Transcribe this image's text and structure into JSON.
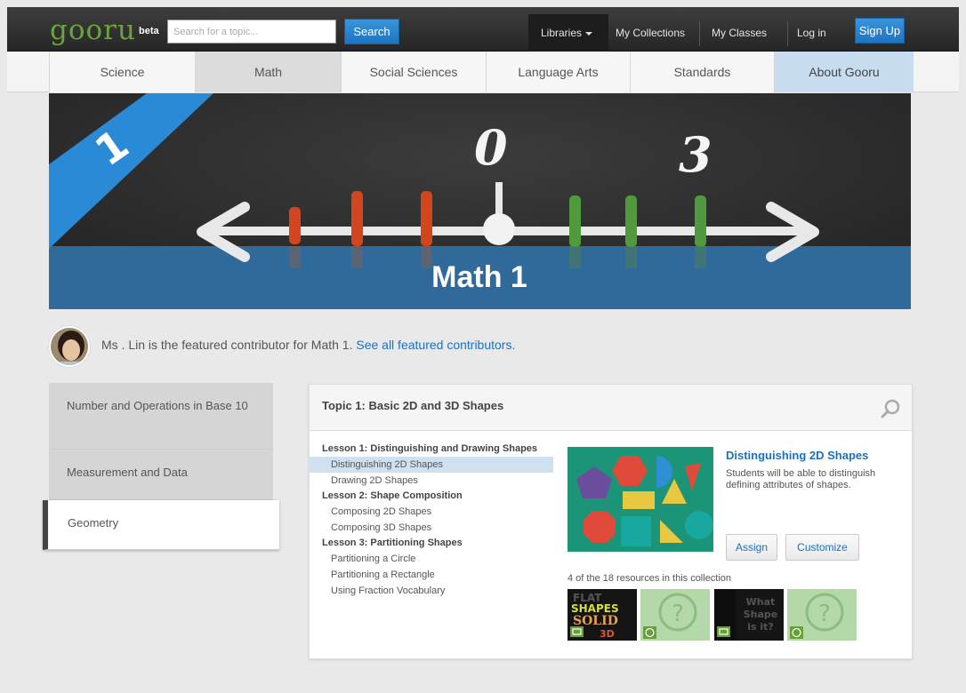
{
  "header": {
    "logo": "gooru",
    "beta": "beta",
    "search_placeholder": "Search for a topic...",
    "search_button": "Search",
    "libraries": "Libraries",
    "my_collections": "My Collections",
    "my_classes": "My Classes",
    "login": "Log in",
    "signup": "Sign Up"
  },
  "tabs": [
    "Science",
    "Math",
    "Social Sciences",
    "Language Arts",
    "Standards",
    "About Gooru"
  ],
  "banner": {
    "title": "Math 1",
    "grade": "1",
    "numbers": [
      "0",
      "3"
    ]
  },
  "contributor": {
    "text": "Ms . Lin is the featured contributor for Math 1.",
    "link": "See all featured contributors."
  },
  "sidebar": {
    "items": [
      {
        "label": "Number and Operations in Base 10"
      },
      {
        "label": "Measurement and Data"
      },
      {
        "label": "Geometry"
      }
    ]
  },
  "topic": {
    "title": "Topic 1: Basic 2D and 3D Shapes",
    "lessons": [
      {
        "title": "Lesson 1: Distinguishing and Drawing Shapes",
        "items": [
          "Distinguishing 2D Shapes",
          "Drawing 2D Shapes"
        ]
      },
      {
        "title": "Lesson 2: Shape Composition",
        "items": [
          "Composing 2D Shapes",
          "Composing 3D Shapes"
        ]
      },
      {
        "title": "Lesson 3: Partitioning Shapes",
        "items": [
          "Partitioning a Circle",
          "Partitioning a Rectangle",
          "Using Fraction Vocabulary"
        ]
      }
    ],
    "resource": {
      "title": "Distinguishing 2D Shapes",
      "description": "Students will be able to distinguish defining attributes of shapes.",
      "assign": "Assign",
      "customize": "Customize",
      "count": "4 of the 18 resources in this collection"
    },
    "thumbs": [
      {
        "text": [
          "FLAT",
          "SHAPES",
          "SOLID",
          "3D"
        ]
      },
      {
        "text": [
          "?"
        ]
      },
      {
        "text": [
          "What",
          "Shape",
          "is it?"
        ]
      },
      {
        "text": [
          "?"
        ]
      }
    ]
  }
}
